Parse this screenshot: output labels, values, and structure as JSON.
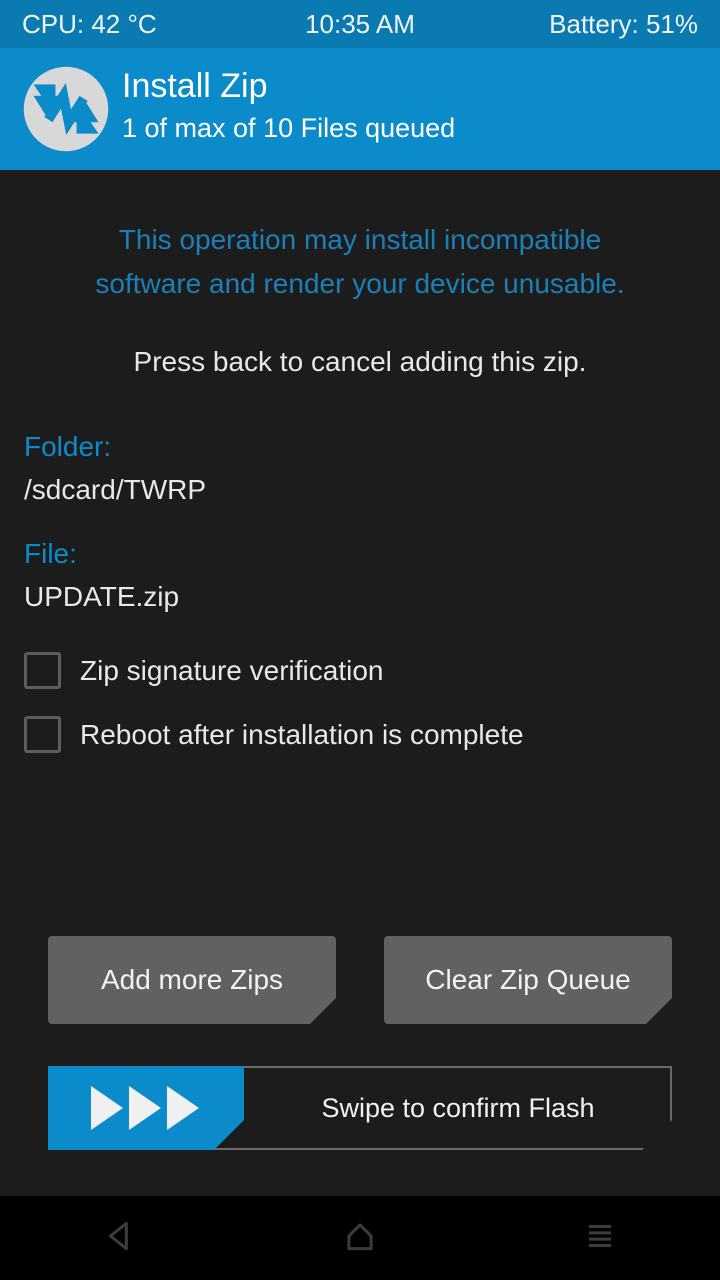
{
  "statusbar": {
    "cpu": "CPU: 42 °C",
    "clock": "10:35 AM",
    "battery": "Battery: 51%",
    "bg_color": "#0b7ab0"
  },
  "header": {
    "logo_icon": "twrp-logo-icon",
    "title": "Install Zip",
    "subtitle": "1 of max of 10 Files queued",
    "bg_color": "#0b8bc9"
  },
  "main": {
    "warning_line1": "This operation may install incompatible",
    "warning_line2": "software and render your device unusable.",
    "warning_color": "#1b7fb8",
    "instruction": "Press back to cancel adding this zip.",
    "folder_label": "Folder:",
    "folder_value": "/sdcard/TWRP",
    "file_label": "File:",
    "file_value": "UPDATE.zip",
    "label_color": "#0b8bc9",
    "bg_color": "#1c1c1c",
    "checkboxes": [
      {
        "label": "Zip signature verification",
        "checked": false
      },
      {
        "label": "Reboot after installation is complete",
        "checked": false
      }
    ],
    "buttons": {
      "add_more_zips": "Add more Zips",
      "clear_zip_queue": "Clear Zip Queue",
      "button_color": "#616161"
    },
    "swipe": {
      "text": "Swipe to confirm Flash",
      "slider_color": "#0b8bc9",
      "arrow_icon": "play-arrow-icon",
      "arrow_count": 3
    }
  },
  "navbar": {
    "back_icon": "back-triangle-icon",
    "home_icon": "home-icon",
    "menu_icon": "menu-lines-icon",
    "bg_color": "#000000"
  }
}
